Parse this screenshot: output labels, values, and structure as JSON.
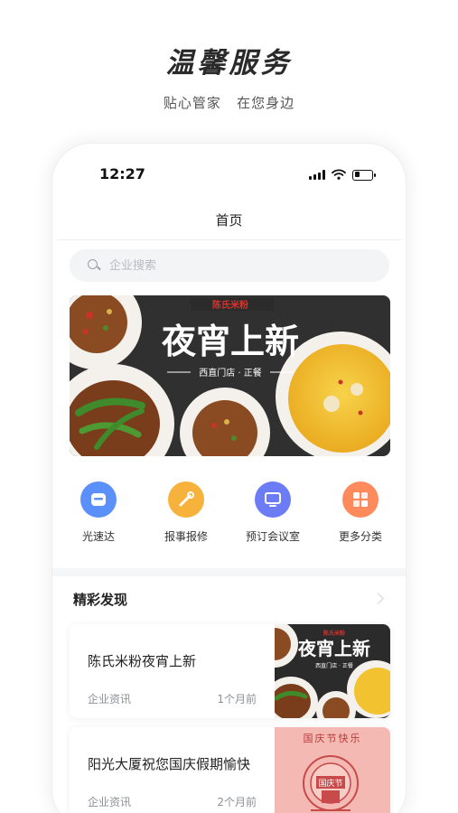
{
  "promo": {
    "title": "温馨服务",
    "subtitle": "贴心管家   在您身边"
  },
  "status_bar": {
    "time": "12:27",
    "icons": [
      "signal-icon",
      "wifi-icon",
      "battery-icon"
    ],
    "battery_level": 0.3
  },
  "nav": {
    "title": "首页"
  },
  "search": {
    "placeholder": "企业搜索",
    "value": ""
  },
  "banner": {
    "brand": "陈氏米粉",
    "headline": "夜宵上新",
    "tagline": "西直门店 · 正餐"
  },
  "categories": [
    {
      "label": "光速达",
      "icon": "courier-icon",
      "color": "#5b8ff9"
    },
    {
      "label": "报事报修",
      "icon": "repair-icon",
      "color": "#f7b23b"
    },
    {
      "label": "预订会议室",
      "icon": "meeting-room-icon",
      "color": "#6b7cf6"
    },
    {
      "label": "更多分类",
      "icon": "more-categories-icon",
      "color": "#ff8a5c"
    }
  ],
  "discover": {
    "title": "精彩发现",
    "items": [
      {
        "title": "陈氏米粉夜宵上新",
        "source": "企业资讯",
        "time": "1个月前",
        "thumb": {
          "brand": "陈氏米粉",
          "headline": "夜宵上新",
          "tagline": "西直门店 · 正餐"
        }
      },
      {
        "title": "阳光大厦祝您国庆假期愉快",
        "source": "企业资讯",
        "time": "2个月前",
        "thumb": {
          "headline": "国庆节快乐",
          "seal_text": "国庆节"
        }
      }
    ]
  },
  "colors": {
    "banner_bg": "#2b2b2b",
    "brand_red": "#d8322b",
    "soup_yellow": "#f2c230",
    "holiday_pink": "#f4b9b2"
  }
}
